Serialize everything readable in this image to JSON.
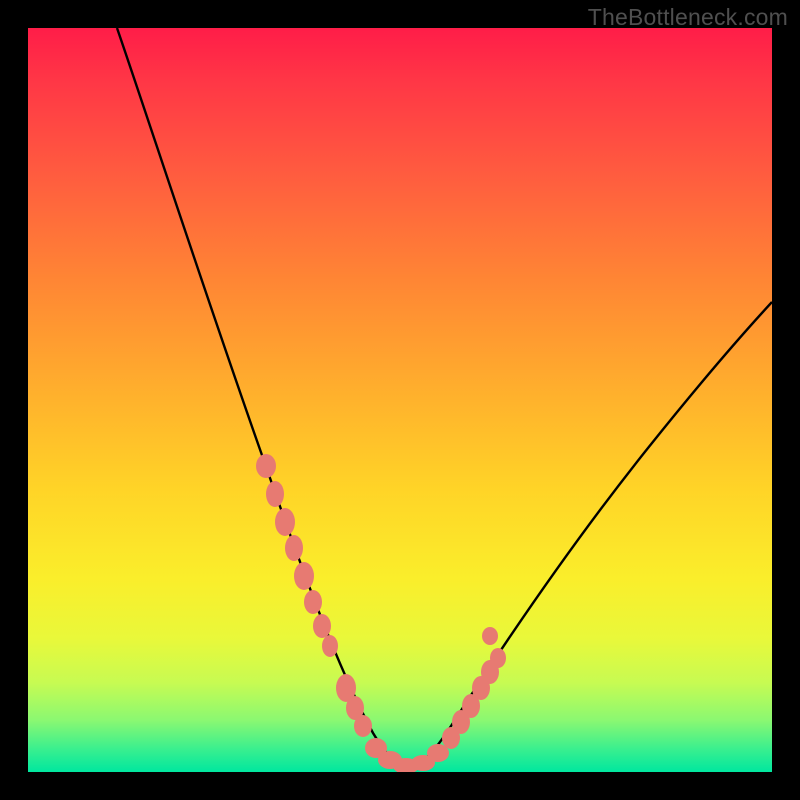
{
  "watermark": "TheBottleneck.com",
  "chart_data": {
    "type": "line",
    "title": "",
    "xlabel": "",
    "ylabel": "",
    "xlim": [
      0,
      100
    ],
    "ylim": [
      0,
      100
    ],
    "series": [
      {
        "name": "bottleneck-curve",
        "x": [
          12,
          15,
          20,
          25,
          28,
          30,
          32,
          34,
          36,
          38,
          40,
          42,
          44,
          46,
          48,
          50,
          52,
          56,
          60,
          65,
          70,
          75,
          80,
          85,
          90,
          95,
          100
        ],
        "values": [
          100,
          92,
          78,
          63,
          54,
          48,
          41,
          35,
          28,
          21,
          15,
          10,
          6,
          3,
          1,
          0,
          1,
          3,
          7,
          13,
          20,
          27,
          34,
          41,
          47,
          53,
          58
        ]
      }
    ],
    "markers": {
      "name": "highlighted-points",
      "points": [
        {
          "x": 32,
          "y": 41
        },
        {
          "x": 33,
          "y": 37
        },
        {
          "x": 34,
          "y": 35
        },
        {
          "x": 35,
          "y": 31
        },
        {
          "x": 36,
          "y": 28
        },
        {
          "x": 37,
          "y": 24
        },
        {
          "x": 38,
          "y": 21
        },
        {
          "x": 39,
          "y": 18
        },
        {
          "x": 40,
          "y": 15
        },
        {
          "x": 43,
          "y": 8
        },
        {
          "x": 44,
          "y": 6
        },
        {
          "x": 45,
          "y": 4
        },
        {
          "x": 47,
          "y": 2
        },
        {
          "x": 48,
          "y": 1
        },
        {
          "x": 49,
          "y": 0.5
        },
        {
          "x": 50,
          "y": 0
        },
        {
          "x": 53,
          "y": 1.5
        },
        {
          "x": 55,
          "y": 2.5
        },
        {
          "x": 56,
          "y": 3
        },
        {
          "x": 57,
          "y": 4
        },
        {
          "x": 58,
          "y": 5
        },
        {
          "x": 59,
          "y": 6
        },
        {
          "x": 60,
          "y": 7
        },
        {
          "x": 62,
          "y": 10
        },
        {
          "x": 63,
          "y": 11.5
        },
        {
          "x": 64,
          "y": 13
        }
      ]
    },
    "gradient_stops": [
      {
        "pos": 0,
        "color": "#ff1d48"
      },
      {
        "pos": 50,
        "color": "#ffc028"
      },
      {
        "pos": 100,
        "color": "#00e79f"
      }
    ]
  }
}
